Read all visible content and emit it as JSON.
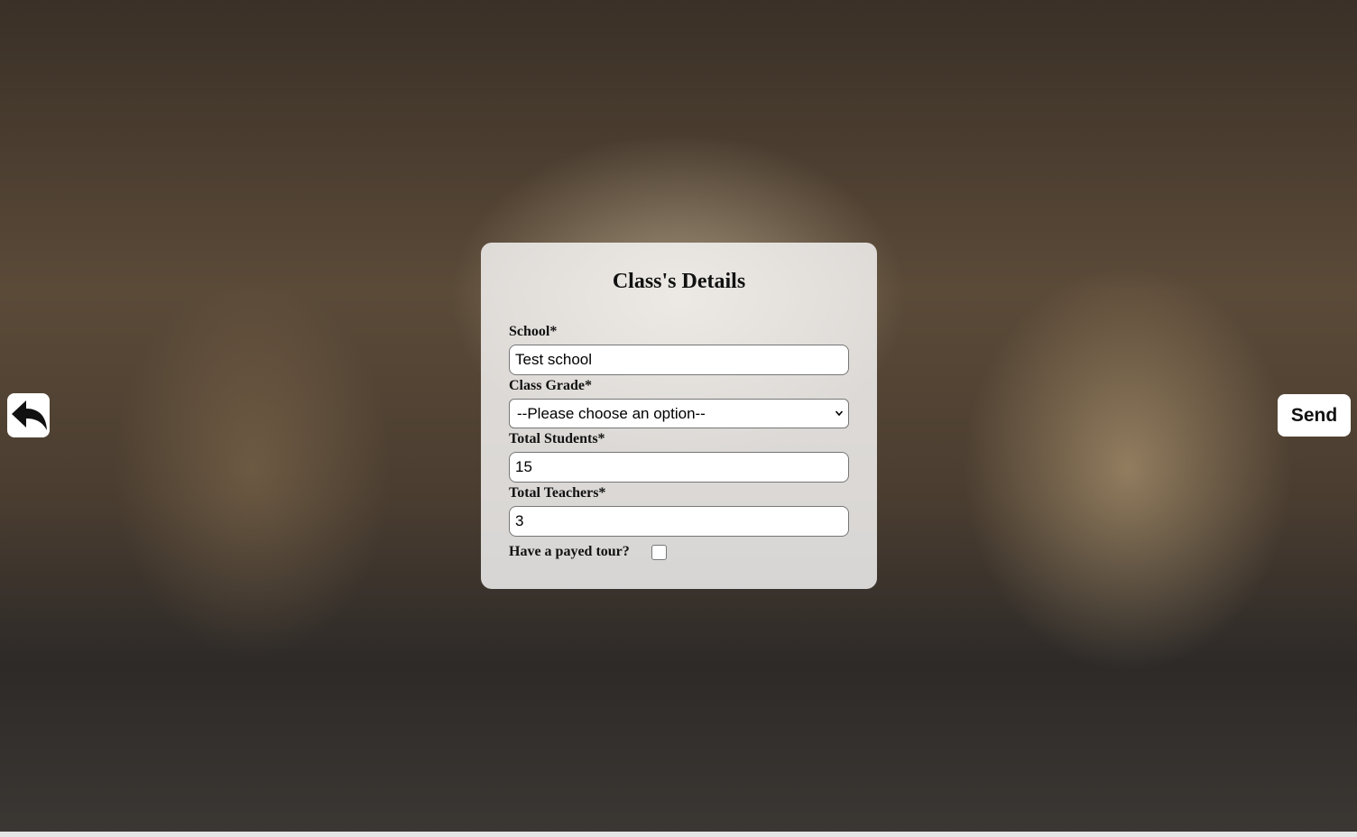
{
  "form": {
    "title": "Class's Details",
    "school_label": "School*",
    "school_value": "Test school",
    "grade_label": "Class Grade*",
    "grade_selected": "--Please choose an option--",
    "students_label": "Total Students*",
    "students_value": "15",
    "teachers_label": "Total Teachers*",
    "teachers_value": "3",
    "paid_tour_label": "Have a payed tour?",
    "paid_tour_checked": false
  },
  "actions": {
    "back_icon": "reply-arrow-icon",
    "send_label": "Send"
  }
}
